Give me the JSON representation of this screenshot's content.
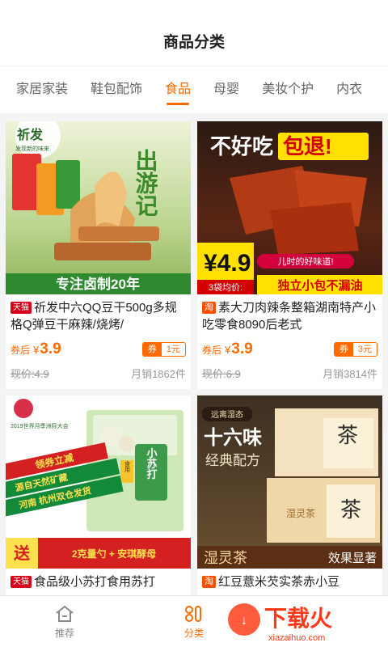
{
  "header": {
    "title": "商品分类"
  },
  "tabs": [
    {
      "label": "家居家装"
    },
    {
      "label": "鞋包配饰"
    },
    {
      "label": "食品"
    },
    {
      "label": "母婴"
    },
    {
      "label": "美妆个护"
    },
    {
      "label": "内衣"
    }
  ],
  "products": [
    {
      "platform": "天猫",
      "title": "祈发中六QQ豆干500g多规格Q弹豆干麻辣/烧烤/",
      "coupon_label": "券后",
      "price_symbol": "¥",
      "price": "3.9",
      "coupon_tag": "券",
      "coupon_amount": "1元",
      "original_price": "现价:4.9",
      "sales": "月销1862件",
      "image": {
        "brand": "祈发",
        "brand_sub": "发现新的味来",
        "slogan": "出游记",
        "banner": "专注卤制20年"
      }
    },
    {
      "platform": "淘",
      "title": "素大刀肉辣条整箱湖南特产小吃零食8090后老式",
      "coupon_label": "券后",
      "price_symbol": "¥",
      "price": "3.9",
      "coupon_tag": "券",
      "coupon_amount": "3元",
      "original_price": "现价:6.9",
      "sales": "月销3814件",
      "image": {
        "headline_a": "不好吃",
        "headline_b": "包退!",
        "price_big": "¥4.9",
        "price_note": "3袋均价:",
        "tag": "儿时的好味道!",
        "banner": "独立小包不漏油"
      }
    },
    {
      "platform": "天猫",
      "title": "食品级小苏打食用苏打",
      "image": {
        "ribbon_top": "领券立减",
        "line1": "源自天然矿藏",
        "line2": "河南 杭州双仓发货",
        "pack": "小苏打",
        "pack_tag": "食用",
        "send": "送",
        "bottom": "2克量勺 + 安琪酵母",
        "expo": "2019世界月季洲际大会"
      }
    },
    {
      "platform": "淘",
      "title": "红豆薏米芡实茶赤小豆",
      "image": {
        "top": "远离湿态",
        "big": "十六味",
        "sub": "经典配方",
        "box": "湿灵茶",
        "box_char": "茶",
        "bottom_left": "湿灵茶",
        "bottom_right": "效果显著"
      }
    }
  ],
  "bottom_nav": [
    {
      "label": "推荐",
      "icon": "home-icon"
    },
    {
      "label": "分类",
      "icon": "category-icon"
    }
  ],
  "watermark": {
    "text": "下载火",
    "url": "xiazaihuo.com"
  },
  "colors": {
    "accent": "#ff6a00",
    "tmall": "#d9001b",
    "taobao": "#ff5000"
  }
}
